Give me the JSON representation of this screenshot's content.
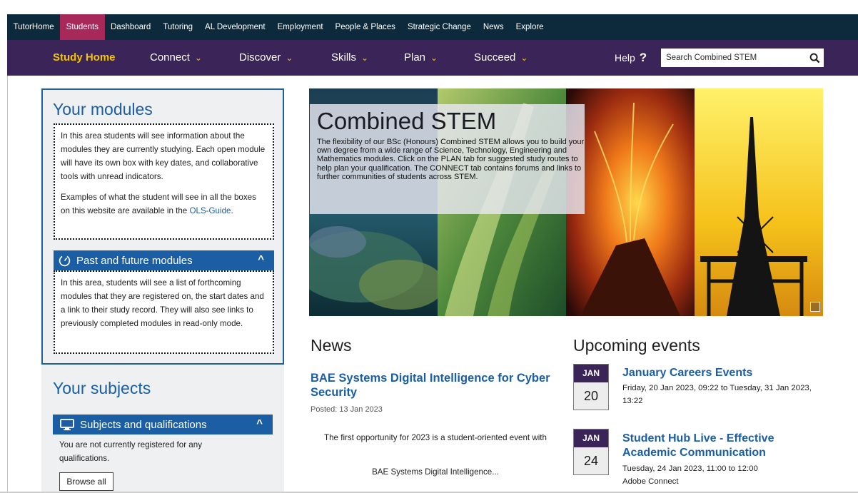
{
  "topbar": {
    "links": [
      {
        "label": "TutorHome"
      },
      {
        "label": "Students",
        "active": true
      },
      {
        "label": "Dashboard"
      },
      {
        "label": "Tutoring"
      },
      {
        "label": "AL Development"
      },
      {
        "label": "Employment"
      },
      {
        "label": "People & Places"
      },
      {
        "label": "Strategic Change"
      },
      {
        "label": "News"
      },
      {
        "label": "Explore"
      }
    ]
  },
  "subnav": {
    "home": "Study Home",
    "connect": "Connect",
    "discover": "Discover",
    "skills": "Skills",
    "plan": "Plan",
    "succeed": "Succeed",
    "help": "Help",
    "help_icon": "?",
    "chevron_icon": "chevron-down-icon",
    "search_placeholder": "Search Combined STEM",
    "search_icon": "search-icon"
  },
  "modules": {
    "title": "Your modules",
    "intro_1": "In this area students will see information about the modules they are currently studying. Each open module will have its own box with key dates, and collaborative tools with unread indicators.",
    "intro_2_prefix": "Examples of what the student will see in all the boxes on this website are available in the",
    "guide_link": "OLS-Guide",
    "intro_2_suffix": ".",
    "past_header": "Past and future modules",
    "past_body": "In this area, students will see a list of forthcoming modules that they are registered on, the start dates and a link to their study record. They will also see links to previously completed modules in read-only mode."
  },
  "subjects": {
    "title": "Your subjects",
    "header": "Subjects and qualifications",
    "body": "You are not currently registered for any qualifications.",
    "button": "Browse all"
  },
  "hero": {
    "title": "Combined STEM",
    "description": "The flexibility of our BSc (Honours) Combined STEM allows you to build your own degree from a wide range of Science, Technology, Engineering and Mathematics modules.  Click on the PLAN tab for suggested study routes to help plan your qualification. The CONNECT tab contains forums and links to further communities of students across STEM."
  },
  "news": {
    "title": "News",
    "item_title": "BAE Systems Digital Intelligence for Cyber Security",
    "posted": "Posted: 13 Jan 2023",
    "body": "The first opportunity for 2023 is a student-oriented event with",
    "more": "BAE Systems Digital Intelligence..."
  },
  "events": {
    "title": "Upcoming events",
    "items": [
      {
        "month": "JAN",
        "day": "20",
        "title": "January Careers Events",
        "time": "Friday, 20 Jan 2023, 09:22 to Tuesday, 31 Jan 2023, 13:22"
      },
      {
        "month": "JAN",
        "day": "24",
        "title": "Student Hub Live - Effective Academic Communication",
        "time": "Tuesday, 24 Jan 2023, 11:00 to 12:00",
        "location": "Adobe Connect"
      }
    ]
  },
  "colors": {
    "topbar": "#0d2a3c",
    "active_tab": "#a7295a",
    "subnav": "#3b2558",
    "accent_yellow": "#f5c400",
    "link_blue": "#1b5ea3"
  }
}
